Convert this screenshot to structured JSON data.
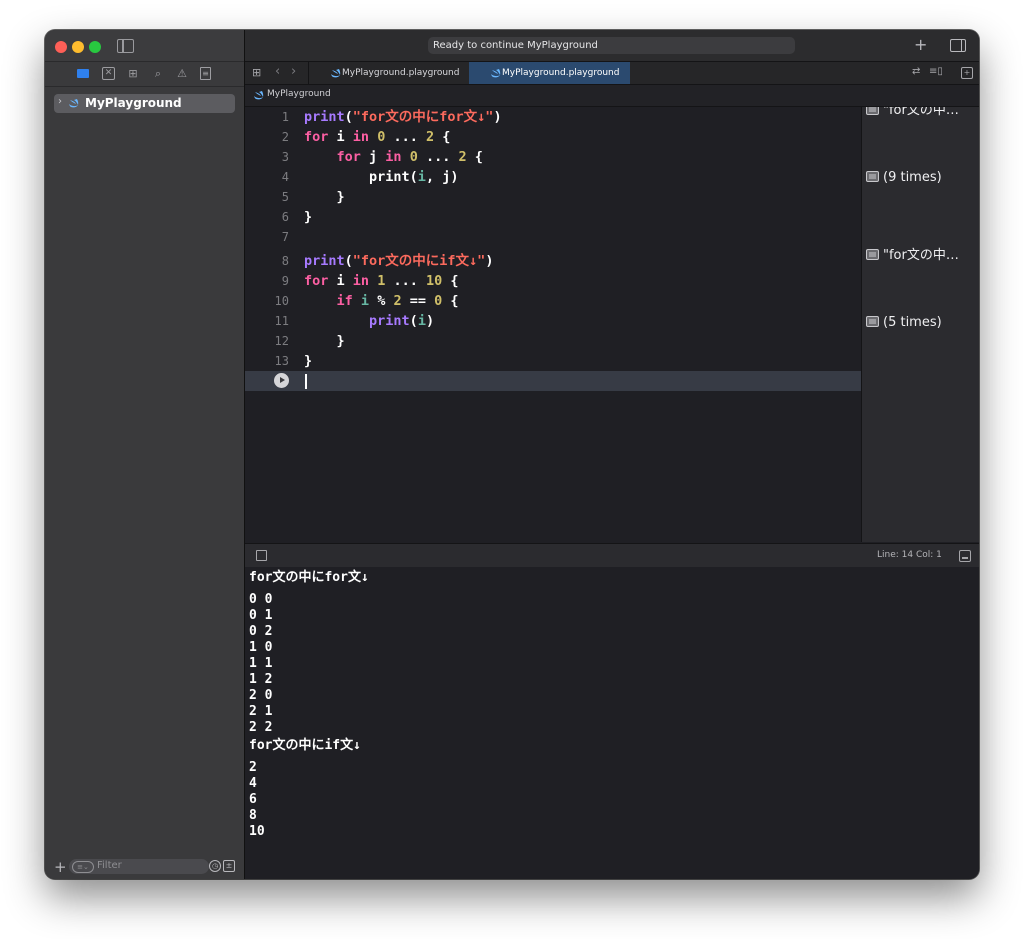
{
  "window": {
    "status_text": "Ready to continue MyPlayground"
  },
  "sidebar": {
    "project_item": "MyPlayground",
    "filter_placeholder": "Filter"
  },
  "tabs": [
    {
      "label": "MyPlayground.playground",
      "active": false
    },
    {
      "label": "MyPlayground.playground",
      "active": true
    }
  ],
  "jumpbar": {
    "label": "MyPlayground"
  },
  "editor": {
    "lines": [
      "1",
      "2",
      "3",
      "4",
      "5",
      "6",
      "7",
      "8",
      "9",
      "10",
      "11",
      "12",
      "13"
    ]
  },
  "results": [
    "\"for文の中…",
    "(9 times)",
    "\"for文の中…",
    "(5 times)"
  ],
  "debug": {
    "position": "Line: 14  Col: 1"
  },
  "console": {
    "lines": [
      "for文の中にfor文↓",
      "0 0",
      "0 1",
      "0 2",
      "1 0",
      "1 1",
      "1 2",
      "2 0",
      "2 1",
      "2 2",
      "for文の中にif文↓",
      "2",
      "4",
      "6",
      "8",
      "10"
    ]
  },
  "colors": {
    "keyword": "#fc5fa3",
    "function": "#a77aff",
    "string": "#fc6a5d",
    "number": "#d0bf69",
    "variable": "#67b7a4",
    "active_tab": "#2b4a6f"
  }
}
